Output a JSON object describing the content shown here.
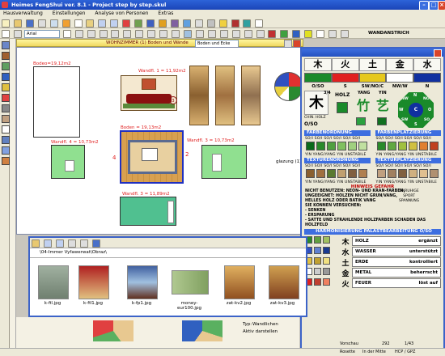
{
  "app": {
    "title": "Heimes FengShui ver. 8.1 - Project step by step.skul"
  },
  "menu": [
    "Hausverwaltung",
    "Einstellungen",
    "Analyse von Personen",
    "Extras"
  ],
  "format": {
    "font": "Arial",
    "wandanstrich": "WANDANSTRICH"
  },
  "document": {
    "title": "WOHNZIMMER (1) Boden und Wände",
    "view_select": "Boden und Ecke",
    "labels": {
      "bodeo": "Bodeo=19,12m2",
      "wand1": "Wandfl. 1 = 11,92m2",
      "wand4": "Wandfl. 4 = 10,73m2",
      "boden": "Boden = 19,13m2",
      "wand3": "Wandfl. 3 = 10,73m2",
      "wand2": "Wandfl. 3 = 11,89m2",
      "num4": "4",
      "num2": "2",
      "num3": "3",
      "side": "glazung (1)"
    }
  },
  "fengshui": {
    "elements": [
      "木",
      "火",
      "土",
      "金",
      "水"
    ],
    "element_labels": [
      "O/SO",
      "S",
      "SW/NO/C",
      "NW/W",
      "N"
    ],
    "element_colors": [
      "#1a8a2a",
      "#e02020",
      "#e6c81c",
      "#ffffff",
      "#1030a0"
    ],
    "holz_label": "HOLZ",
    "yang_label": "YANG",
    "yin_label": "YIN",
    "chin_holz": "CHIN. HOLZ",
    "chin_osc": "O/SO",
    "holz_num": "3/4",
    "compass": [
      "N",
      "NW",
      "W",
      "SW",
      "S",
      "SO",
      "O",
      "NO",
      "C"
    ],
    "sections": {
      "farben": "FARBENORDNUNG",
      "farbplatz": "FARBENPLATZIERUNG",
      "textur": "TEXTURENORDNUNG",
      "texturplatz": "TEXTURPLATZIERUNG",
      "hinweis": "HINWEIS GEFAHR",
      "harmonie": "HARMONISIERUNG PALASTBEARBEITUNG  O/SO"
    },
    "scale_row": "SO/I  SO/I  SO/I  SO/I  SO/I  SO/I",
    "yin_row": "YIN  YANG/YANG  YIN  UNSTABILE",
    "hint_lines": [
      "NICHT BENUTZEN: NEON- UND KRAN-FARBEN,",
      "UNGEEIGNET: HOLZEN NICHT GRUN/VANG,",
      "HELLES HOLZ ODER BATIK VANG",
      "SIE KONNEN VERSUCHEN:",
      "- SENKEN",
      "- ERSPARUNG",
      "- SATTE UND STRAHLENDE HOLZFARBEN SCHADEN DAS HOLZFELD"
    ],
    "hint_side": [
      "UNRUHIGE",
      "SPORT",
      "SPANNUNG"
    ],
    "harm": [
      {
        "ch": "木",
        "name": "HOLZ",
        "effect": "ergänzt"
      },
      {
        "ch": "水",
        "name": "WASSER",
        "effect": "unterstützt"
      },
      {
        "ch": "土",
        "name": "ERDE",
        "effect": "kontrolliert"
      },
      {
        "ch": "金",
        "name": "METAL",
        "effect": "beherrscht"
      },
      {
        "ch": "火",
        "name": "FEUER",
        "effect": "löst auf"
      }
    ]
  },
  "explorer": {
    "path": "\\04-Immer Vyfawerwat\\Obraz\\",
    "files": [
      "k-fil.jpg",
      "k-fil1.jpg",
      "k-fp1.jpg",
      "money-eur100.jpg",
      "zat-kv2.jpg",
      "zat-kv3.jpg"
    ]
  },
  "bottom": {
    "typ": "Typ:",
    "wandlichen": "Wandlichen",
    "aktiv": "Aktiv darstellen",
    "rosette": "Rosette",
    "mitte": "In der Mitte",
    "hcp": "HCP / GPZ",
    "vorschau": "Vorschau",
    "zoom": "292",
    "ratio": "1/43"
  }
}
